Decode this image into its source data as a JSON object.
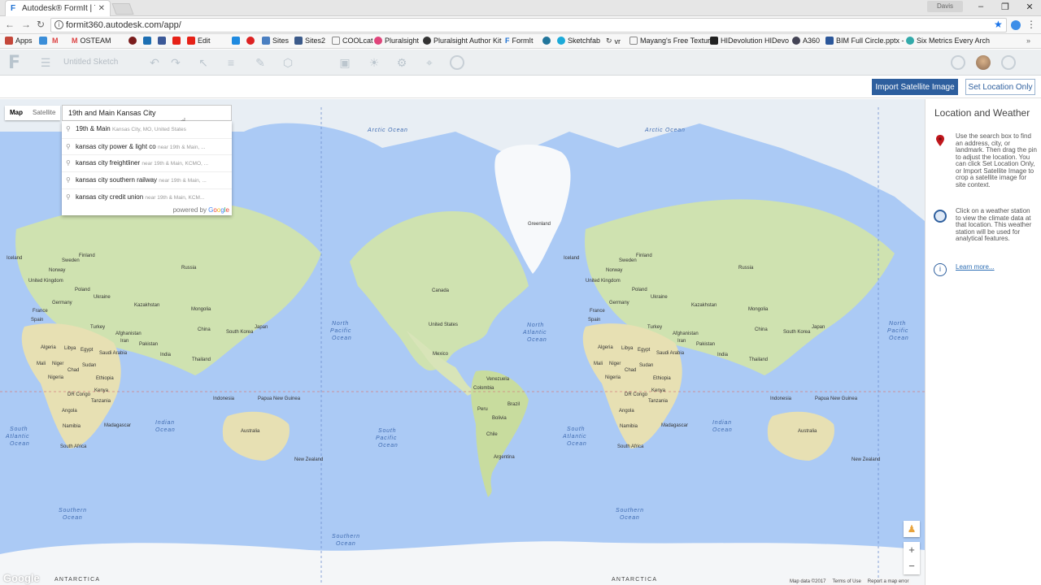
{
  "browser": {
    "tab_title": "Autodesk® FormIt | Thir",
    "url": "formit360.autodesk.com/app/",
    "user_label": "Davis",
    "bookmarks": [
      "Apps",
      "OSTEAM",
      "Edit",
      "Sites",
      "Sites2",
      "COOLcat",
      "Pluralsight",
      "Pluralsight Author Kit",
      "FormIt",
      "Sketchfab",
      "vr",
      "Mayang's Free Textur",
      "HIDevolution HIDevo",
      "A360",
      "BIM Full Circle.pptx -",
      "Six Metrics Every Arch"
    ]
  },
  "app": {
    "logo": "F",
    "sketch_title": "Untitled Sketch"
  },
  "actions": {
    "import_label": "Import Satellite Image",
    "setloc_label": "Set Location Only"
  },
  "map": {
    "type_map": "Map",
    "type_satellite": "Satellite",
    "search_value": "19th and Main Kansas City",
    "suggestions": [
      {
        "main": "19th & Main",
        "secondary": "Kansas City, MO, United States"
      },
      {
        "main": "kansas city power & light co",
        "secondary": "near 19th & Main, ..."
      },
      {
        "main": "kansas city freightliner",
        "secondary": "near 19th & Main, KCMO, ..."
      },
      {
        "main": "kansas city southern railway",
        "secondary": "near 19th & Main, ..."
      },
      {
        "main": "kansas city credit union",
        "secondary": "near 19th & Main, KCM..."
      }
    ],
    "powered_by": "powered by",
    "google_word": "Google",
    "zoom_in": "+",
    "zoom_out": "−",
    "logo": "Google",
    "attribution": [
      "Map data ©2017",
      "Terms of Use",
      "Report a map error"
    ],
    "labels": {
      "arctic": "Arctic Ocean",
      "n_pacific": [
        "North",
        "Pacific",
        "Ocean"
      ],
      "n_atlantic": [
        "North",
        "Atlantic",
        "Ocean"
      ],
      "s_atlantic": [
        "South",
        "Atlantic",
        "Ocean"
      ],
      "s_pacific": [
        "South",
        "Pacific",
        "Ocean"
      ],
      "indian": [
        "Indian",
        "Ocean"
      ],
      "southern": [
        "Southern",
        "Ocean"
      ],
      "antarctica": "ANTARCTICA",
      "countries": [
        "Greenland",
        "Iceland",
        "Sweden",
        "Norway",
        "Finland",
        "Russia",
        "United Kingdom",
        "Poland",
        "Germany",
        "France",
        "Spain",
        "Ukraine",
        "Kazakhstan",
        "Mongolia",
        "China",
        "Turkey",
        "Iran",
        "Afghanistan",
        "Pakistan",
        "India",
        "Saudi Arabia",
        "Egypt",
        "Libya",
        "Algeria",
        "Mali",
        "Niger",
        "Chad",
        "Sudan",
        "Nigeria",
        "Ethiopia",
        "Kenya",
        "DR Congo",
        "Tanzania",
        "Angola",
        "Namibia",
        "South Africa",
        "Madagascar",
        "Thailand",
        "South Korea",
        "Japan",
        "Indonesia",
        "Papua New Guinea",
        "Australia",
        "New Zealand",
        "Canada",
        "United States",
        "Mexico",
        "Venezuela",
        "Colombia",
        "Peru",
        "Brazil",
        "Bolivia",
        "Chile",
        "Argentina"
      ]
    }
  },
  "panel": {
    "title": "Location and Weather",
    "pin_text": "Use the search box to find an address, city, or landmark. Then drag the pin to adjust the location. You can click Set Location Only, or Import Satellite Image to crop a satellite image for site context.",
    "weather_text": "Click on a weather station to view the climate data at that location. This weather station will be used for analytical features.",
    "learn_more": "Learn more..."
  }
}
